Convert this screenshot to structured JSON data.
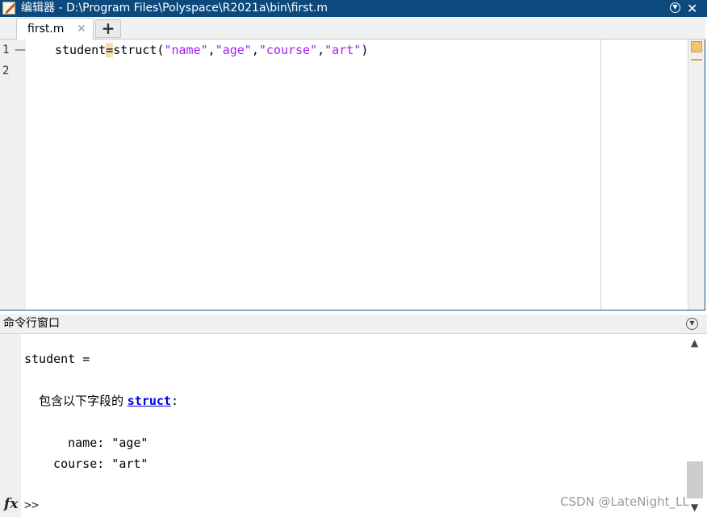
{
  "window": {
    "title": "编辑器 - D:\\Program Files\\Polyspace\\R2021a\\bin\\first.m",
    "title_icon": "editor-pen-icon",
    "menu_icon": "circle-chevron-down-icon",
    "close_icon": "close-icon"
  },
  "tabs": [
    {
      "label": "first.m",
      "close": "✕"
    }
  ],
  "new_tab_label": "+",
  "editor": {
    "line_numbers": [
      "1",
      "2"
    ],
    "breakpoint_marker": "—",
    "code": {
      "before": "student",
      "cursor": "=",
      "fn": "struct(",
      "s1": "\"name\"",
      "c1": ",",
      "s2": "\"age\"",
      "c2": ",",
      "s3": "\"course\"",
      "c3": ",",
      "s4": "\"art\"",
      "end": ")"
    }
  },
  "command_window": {
    "title": "命令行窗口",
    "line1": "student =",
    "line2_prefix": "包含以下字段的 ",
    "line2_link": "struct",
    "line2_suffix": ":",
    "field_name": "    name: \"age\"",
    "field_course": "  course: \"art\"",
    "fx_label": "fx",
    "prompt": ">>"
  },
  "watermark": "CSDN @LateNight_LL",
  "colors": {
    "titlebar": "#0c4a7e",
    "string": "#a020f0",
    "link": "#0000ee"
  }
}
